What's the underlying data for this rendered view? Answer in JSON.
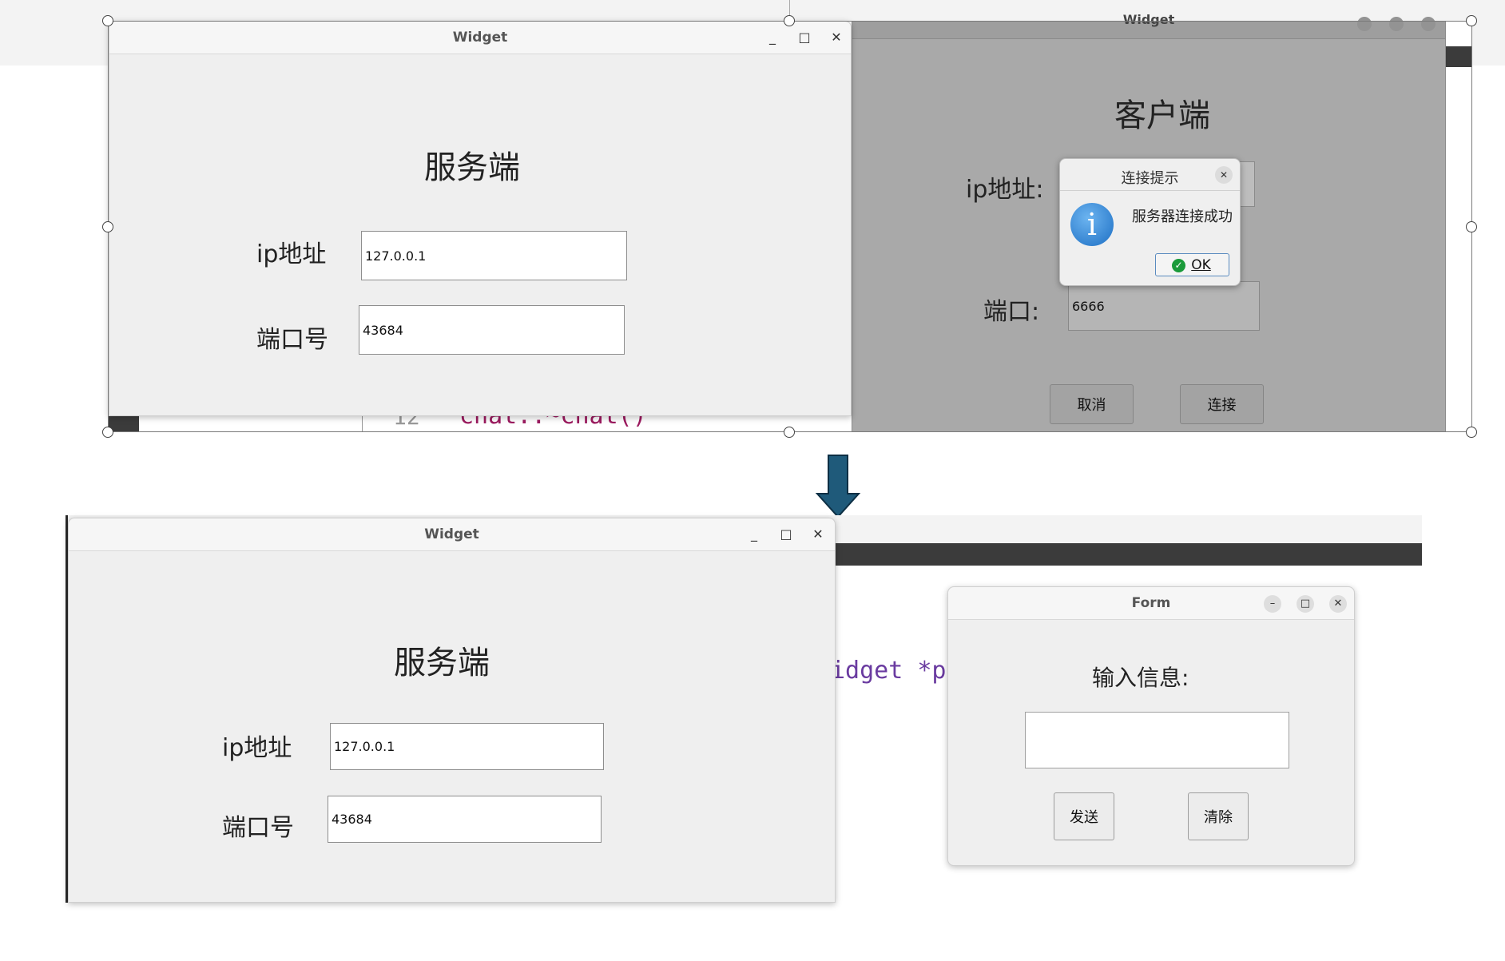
{
  "top": {
    "server": {
      "title": "Widget",
      "minimize": "_",
      "maximize": "□",
      "close": "✕",
      "heading": "服务端",
      "ip_label": "ip地址",
      "ip_value": "127.0.0.1",
      "port_label": "端口号",
      "port_value": "43684"
    },
    "client": {
      "title": "Widget",
      "heading": "客户端",
      "ip_label": "ip地址:",
      "port_label": "端口:",
      "port_value": "6666",
      "cancel": "取消",
      "connect": "连接"
    },
    "dialog": {
      "title": "连接提示",
      "close": "✕",
      "message": "服务器连接成功",
      "ok": "OK",
      "info_glyph": "i"
    },
    "code_fragment": {
      "line_number": "12",
      "text": "chat::~chat()"
    }
  },
  "arrow": {
    "color": "#1f5a7a"
  },
  "bottom": {
    "server": {
      "title": "Widget",
      "minimize": "_",
      "maximize": "□",
      "close": "✕",
      "heading": "服务端",
      "ip_label": "ip地址",
      "ip_value": "127.0.0.1",
      "port_label": "端口号",
      "port_value": "43684"
    },
    "code_fragment": {
      "text": "idget *p"
    },
    "form": {
      "title": "Form",
      "minimize": "–",
      "maximize": "□",
      "close": "✕",
      "prompt": "输入信息:",
      "input_value": "",
      "send": "发送",
      "clear": "清除"
    }
  }
}
